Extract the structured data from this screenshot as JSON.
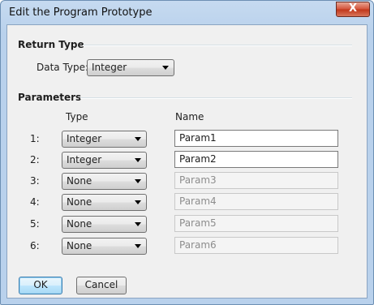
{
  "window": {
    "title": "Edit the Program Prototype",
    "close_glyph": "X"
  },
  "return_type": {
    "heading": "Return Type",
    "data_type_label": "Data Type:",
    "data_type_value": "Integer"
  },
  "parameters": {
    "heading": "Parameters",
    "type_header": "Type",
    "name_header": "Name",
    "rows": [
      {
        "index": "1:",
        "type": "Integer",
        "name": "Param1",
        "enabled": true
      },
      {
        "index": "2:",
        "type": "Integer",
        "name": "Param2",
        "enabled": true
      },
      {
        "index": "3:",
        "type": "None",
        "name": "Param3",
        "enabled": false
      },
      {
        "index": "4:",
        "type": "None",
        "name": "Param4",
        "enabled": false
      },
      {
        "index": "5:",
        "type": "None",
        "name": "Param5",
        "enabled": false
      },
      {
        "index": "6:",
        "type": "None",
        "name": "Param6",
        "enabled": false
      }
    ]
  },
  "buttons": {
    "ok": "OK",
    "cancel": "Cancel"
  },
  "icons": {
    "dropdown": "chevron-down-icon",
    "close": "close-icon"
  }
}
